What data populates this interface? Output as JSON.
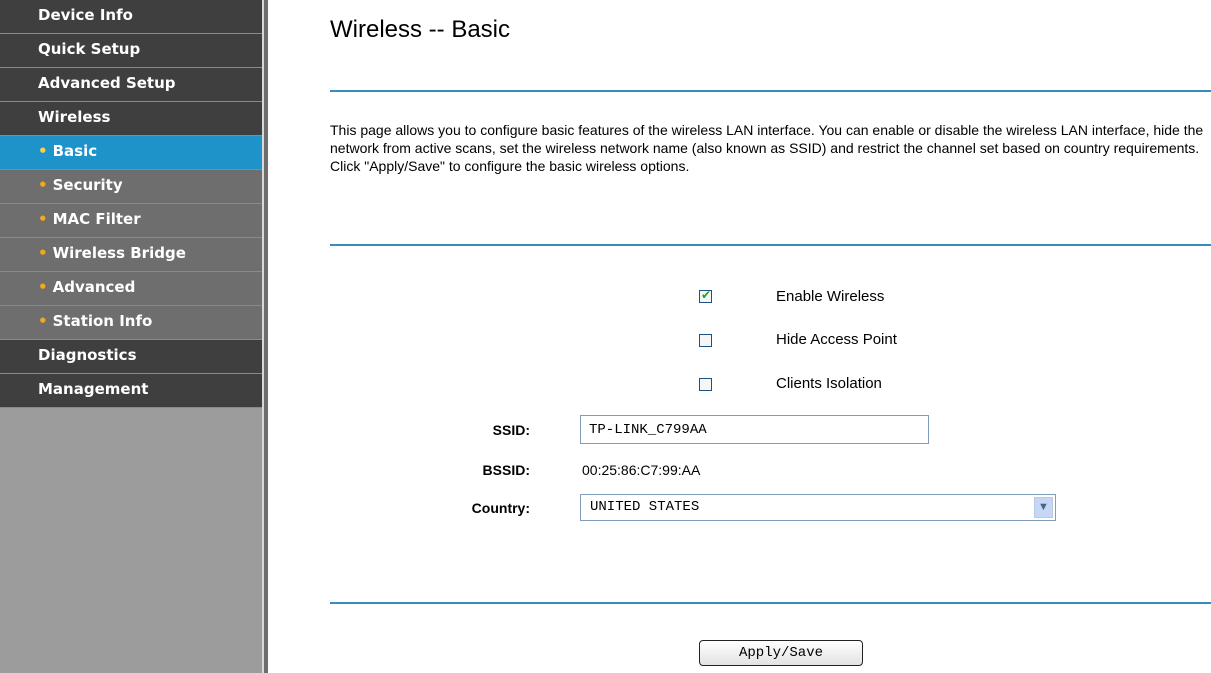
{
  "sidebar": {
    "items": [
      {
        "label": "Device Info",
        "type": "main",
        "active": false
      },
      {
        "label": "Quick Setup",
        "type": "main",
        "active": false
      },
      {
        "label": "Advanced Setup",
        "type": "main",
        "active": false
      },
      {
        "label": "Wireless",
        "type": "main",
        "active": false
      },
      {
        "label": "Basic",
        "type": "sub",
        "active": true
      },
      {
        "label": "Security",
        "type": "sub",
        "active": false
      },
      {
        "label": "MAC Filter",
        "type": "sub",
        "active": false
      },
      {
        "label": "Wireless Bridge",
        "type": "sub",
        "active": false
      },
      {
        "label": "Advanced",
        "type": "sub",
        "active": false
      },
      {
        "label": "Station Info",
        "type": "sub",
        "active": false
      },
      {
        "label": "Diagnostics",
        "type": "main",
        "active": false
      },
      {
        "label": "Management",
        "type": "main",
        "active": false
      }
    ]
  },
  "page": {
    "title": "Wireless -- Basic",
    "intro_line1": "This page allows you to configure basic features of the wireless LAN interface. You can enable or disable the wireless LAN interface, hide the network from active scans, set the wireless network name (also known as SSID) and restrict the channel set based on country requirements.",
    "intro_line2": "Click \"Apply/Save\" to configure the basic wireless options."
  },
  "options": {
    "enable_wireless": {
      "label": "Enable Wireless",
      "checked": true
    },
    "hide_access_point": {
      "label": "Hide Access Point",
      "checked": false
    },
    "clients_isolation": {
      "label": "Clients Isolation",
      "checked": false
    }
  },
  "form": {
    "ssid_label": "SSID:",
    "ssid_value": "TP-LINK_C799AA",
    "bssid_label": "BSSID:",
    "bssid_value": "00:25:86:C7:99:AA",
    "country_label": "Country:",
    "country_value": "UNITED STATES"
  },
  "actions": {
    "apply_label": "Apply/Save"
  },
  "colors": {
    "sidebar_main": "#3f3f3f",
    "sidebar_sub": "#6e6e6e",
    "sidebar_active": "#1d93c9",
    "rule": "#3a8bb8",
    "bullet": "#f2a71c"
  }
}
